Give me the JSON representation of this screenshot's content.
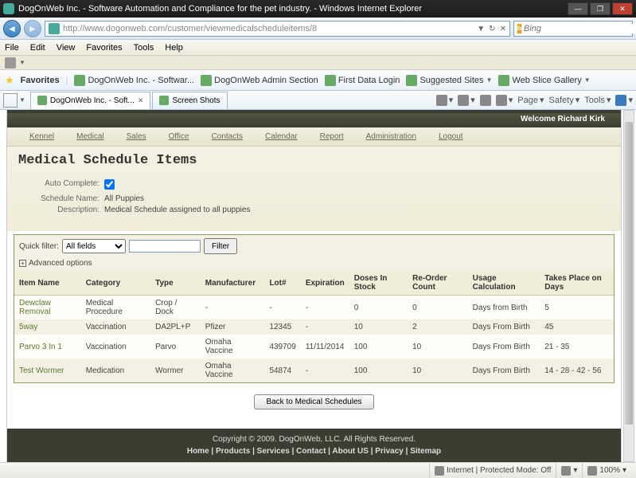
{
  "window": {
    "title": "DogOnWeb Inc. - Software Automation and Compliance for the pet industry. - Windows Internet Explorer",
    "min": "—",
    "max": "❐",
    "close": "✕"
  },
  "address": {
    "url": "http://www.dogonweb.com/customer/viewmedicalscheduleitems/8"
  },
  "search": {
    "engine_label": "b",
    "placeholder": "Bing"
  },
  "menubar": {
    "file": "File",
    "edit": "Edit",
    "view": "View",
    "favorites": "Favorites",
    "tools": "Tools",
    "help": "Help"
  },
  "favbar": {
    "label": "Favorites",
    "items": [
      {
        "label": "DogOnWeb Inc. - Softwar..."
      },
      {
        "label": "DogOnWeb Admin Section"
      },
      {
        "label": "First Data Login"
      },
      {
        "label": "Suggested Sites",
        "drop": true
      },
      {
        "label": "Web Slice Gallery",
        "drop": true
      }
    ]
  },
  "tabs": {
    "t1": "DogOnWeb Inc. - Soft...",
    "t2": "Screen Shots"
  },
  "rtools": {
    "page": "Page",
    "safety": "Safety",
    "tools": "Tools"
  },
  "welcome": "Welcome Richard Kirk",
  "appnav": [
    "Kennel",
    "Medical",
    "Sales",
    "Office",
    "Contacts",
    "Calendar",
    "Report",
    "Administration",
    "Logout"
  ],
  "page_title": "Medical Schedule Items",
  "meta": {
    "auto_complete_label": "Auto Complete:",
    "schedule_name_label": "Schedule Name:",
    "schedule_name_value": "All Puppies",
    "description_label": "Description:",
    "description_value": "Medical Schedule assigned to all puppies"
  },
  "filter": {
    "label": "Quick filter:",
    "field": "All fields",
    "button": "Filter",
    "adv": "Advanced options"
  },
  "columns": [
    "Item Name",
    "Category",
    "Type",
    "Manufacturer",
    "Lot#",
    "Expiration",
    "Doses In Stock",
    "Re-Order Count",
    "Usage Calculation",
    "Takes Place on Days"
  ],
  "rows": [
    {
      "c0": "Dewclaw Removal",
      "c1": "Medical Procedure",
      "c2": "Crop / Dock",
      "c3": "-",
      "c4": "-",
      "c5": "-",
      "c6": "0",
      "c7": "0",
      "c8": "Days from Birth",
      "c9": "5"
    },
    {
      "c0": "5way",
      "c1": "Vaccination",
      "c2": "DA2PL+P",
      "c3": "Pfizer",
      "c4": "12345",
      "c5": "-",
      "c6": "10",
      "c7": "2",
      "c8": "Days From Birth",
      "c9": "45"
    },
    {
      "c0": "Parvo 3 In 1",
      "c1": "Vaccination",
      "c2": "Parvo",
      "c3": "Omaha Vaccine",
      "c4": "439709",
      "c5": "11/11/2014",
      "c6": "100",
      "c7": "10",
      "c8": "Days From Birth",
      "c9": "21 - 35"
    },
    {
      "c0": "Test Wormer",
      "c1": "Medication",
      "c2": "Wormer",
      "c3": "Omaha Vaccine",
      "c4": "54874",
      "c5": "-",
      "c6": "100",
      "c7": "10",
      "c8": "Days From Birth",
      "c9": "14 - 28 - 42 - 56"
    }
  ],
  "back_button": "Back to Medical Schedules",
  "footer": {
    "copyright": "Copyright © 2009.   DogOnWeb, LLC.  All Rights Reserved.",
    "links_text": "Home | Products | Services | Contact | About US | Privacy | Sitemap"
  },
  "status": {
    "mode": "Internet | Protected Mode: Off",
    "zoom": "100%"
  }
}
